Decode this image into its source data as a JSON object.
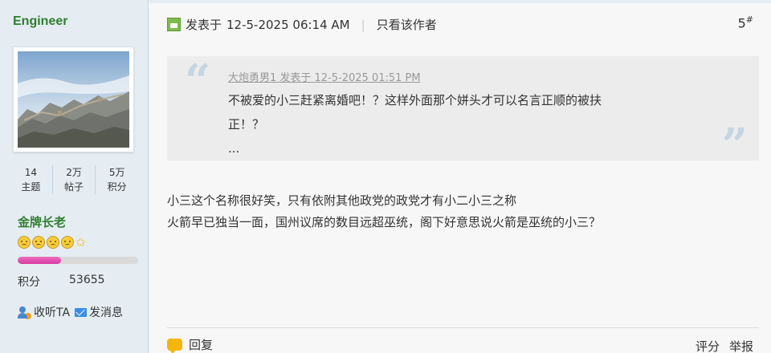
{
  "author": {
    "name": "Engineer",
    "stats": [
      {
        "value": "14",
        "label": "主题"
      },
      {
        "value": "2万",
        "label": "帖子"
      },
      {
        "value": "5万",
        "label": "积分"
      }
    ],
    "rank": "金牌长老",
    "rank_icons": [
      "smiley-icon",
      "smiley-icon",
      "smiley-icon",
      "smiley-icon",
      "star-icon"
    ],
    "level_progress": 0.36,
    "score_label": "积分",
    "score_value": "53655",
    "follow_label": "收听TA",
    "message_label": "发消息"
  },
  "post": {
    "posted_label": "发表于",
    "posted_time": "12-5-2025 06:14 AM",
    "only_author": "只看该作者",
    "floor_number": "5",
    "floor_mark": "#",
    "quote": {
      "meta": "大炮勇男1 发表于 12-5-2025 01:51 PM",
      "line1": "不被爱的小三赶紧离婚吧！？这样外面那个姘头才可以名言正顺的被扶",
      "line2": "正！？",
      "line3": "..."
    },
    "body": [
      "小三这个名称很好笑，只有依附其他政党的政党才有小二小三之称",
      "火箭早已独当一面，国州议席的数目远超巫统，阁下好意思说火箭是巫统的小三？"
    ],
    "reply_label": "回复",
    "rate_label": "评分",
    "report_label": "举报"
  },
  "colors": {
    "sidebar_bg": "#e5edf2",
    "name_green": "#2f7f2f",
    "quote_bg": "#ececec",
    "progress_pink": "#e04bb0"
  }
}
